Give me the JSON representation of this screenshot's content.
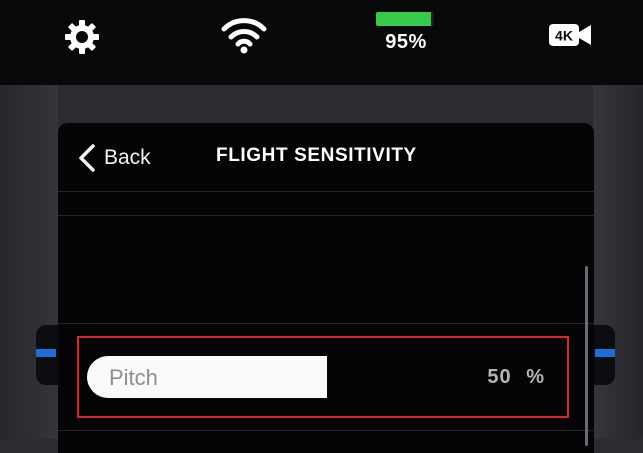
{
  "status": {
    "settings_icon": "gear-icon",
    "wifi_icon": "wifi-icon",
    "battery_percent_value": 95,
    "battery_text": "95%",
    "battery_color": "#38c94a",
    "resolution_label": "4K"
  },
  "panel": {
    "back_label": "Back",
    "title": "FLIGHT SENSITIVITY"
  },
  "pitch": {
    "label": "Pitch",
    "value": 50,
    "value_text": "50",
    "unit": "%"
  },
  "colors": {
    "highlight": "#d8262a",
    "accent_blue": "#1e6ed8"
  }
}
